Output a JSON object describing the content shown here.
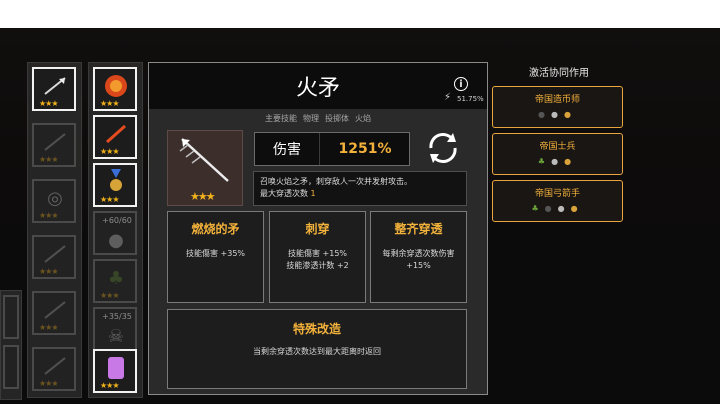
{
  "weapon": {
    "name": "火矛",
    "tags": [
      "主要技能",
      "物理",
      "投掷体",
      "火焰"
    ],
    "crit_percent": "51.75%",
    "damage_label": "伤害",
    "damage_value": "1251%",
    "desc_line1": "召唤火焰之矛，刺穿敌人一次并发射攻击。",
    "desc_line2_prefix": "最大穿透次数",
    "desc_line2_value": "1"
  },
  "upgrades": [
    {
      "title": "燃烧的矛",
      "lines": [
        "技能傷害 +35%"
      ]
    },
    {
      "title": "刺穿",
      "lines": [
        "技能傷害 +15%",
        "技能渗透计数 +2"
      ]
    },
    {
      "title": "整齐穿透",
      "lines": [
        "每剩余穿透次数伤害",
        "+15%"
      ]
    }
  ],
  "special": {
    "title": "特殊改造",
    "text": "当剩余穿透次数达到最大距离时返回"
  },
  "synergy": {
    "title": "激活协同作用",
    "items": [
      {
        "name": "帝国造币师"
      },
      {
        "name": "帝国士兵"
      },
      {
        "name": "帝国弓箭手"
      }
    ]
  },
  "inventory": {
    "slot_counts": [
      "+60/60",
      "+35/35"
    ]
  },
  "colors": {
    "accent": "#f2b13a",
    "synergy_border": "#e9a640"
  }
}
